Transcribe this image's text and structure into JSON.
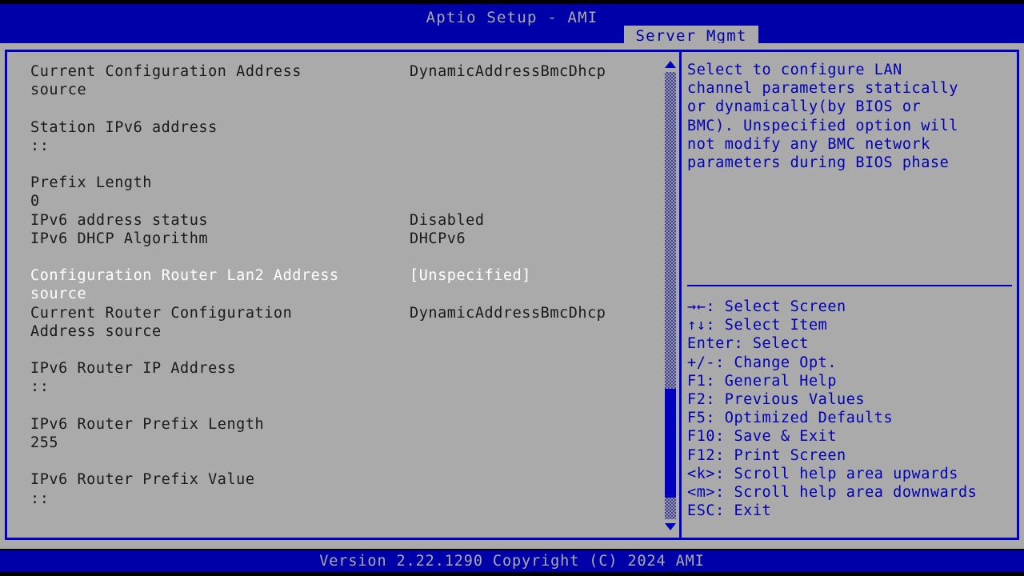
{
  "header": {
    "title": "Aptio Setup - AMI",
    "active_tab": "Server Mgmt",
    "colors": {
      "title_bar": "#0000a8",
      "tab_bg": "#aaaaaa",
      "tab_fg": "#0000a8"
    }
  },
  "settings_list": {
    "selected_index": 7,
    "rows": [
      {
        "label": "Current Configuration Address",
        "value": "DynamicAddressBmcDhcp",
        "selected": false
      },
      {
        "label": "source",
        "value": "",
        "selected": false
      },
      {
        "label": "",
        "value": "",
        "selected": false
      },
      {
        "label": "Station IPv6 address",
        "value": "",
        "selected": false
      },
      {
        "label": "::",
        "value": "",
        "selected": false
      },
      {
        "label": "",
        "value": "",
        "selected": false
      },
      {
        "label": "Prefix Length",
        "value": "",
        "selected": false
      },
      {
        "label": "0",
        "value": "",
        "selected": false
      },
      {
        "label": "IPv6 address status",
        "value": "Disabled",
        "selected": false
      },
      {
        "label": "IPv6 DHCP Algorithm",
        "value": "DHCPv6",
        "selected": false
      },
      {
        "label": "",
        "value": "",
        "selected": false
      },
      {
        "label": "Configuration Router Lan2 Address",
        "value": "[Unspecified]",
        "selected": true
      },
      {
        "label": "source",
        "value": "",
        "selected": true
      },
      {
        "label": "Current Router Configuration",
        "value": "DynamicAddressBmcDhcp",
        "selected": false
      },
      {
        "label": "Address source",
        "value": "",
        "selected": false
      },
      {
        "label": "",
        "value": "",
        "selected": false
      },
      {
        "label": "IPv6 Router IP Address",
        "value": "",
        "selected": false
      },
      {
        "label": "::",
        "value": "",
        "selected": false
      },
      {
        "label": "",
        "value": "",
        "selected": false
      },
      {
        "label": "IPv6 Router Prefix Length",
        "value": "",
        "selected": false
      },
      {
        "label": "255",
        "value": "",
        "selected": false
      },
      {
        "label": "",
        "value": "",
        "selected": false
      },
      {
        "label": "IPv6 Router Prefix Value",
        "value": "",
        "selected": false
      },
      {
        "label": "::",
        "value": "",
        "selected": false
      }
    ]
  },
  "scrollbar": {
    "up_arrow": "scroll-up-arrow",
    "down_arrow": "scroll-down-arrow",
    "thumb_top_pct": 70,
    "thumb_height_pct": 24
  },
  "help": {
    "description_lines": [
      "Select to configure LAN",
      "channel parameters statically",
      "or dynamically(by BIOS or",
      "BMC). Unspecified option will",
      "not modify any BMC network",
      "parameters during BIOS phase"
    ],
    "keys": [
      {
        "key": "→←",
        "text": ": Select Screen"
      },
      {
        "key": "↑↓",
        "text": ": Select Item"
      },
      {
        "key": "Enter",
        "text": ": Select"
      },
      {
        "key": "+/-",
        "text": ": Change Opt."
      },
      {
        "key": "F1",
        "text": ": General Help"
      },
      {
        "key": "F2",
        "text": ": Previous Values"
      },
      {
        "key": "F5",
        "text": ": Optimized Defaults"
      },
      {
        "key": "F10",
        "text": ": Save & Exit"
      },
      {
        "key": "F12",
        "text": ": Print Screen"
      },
      {
        "key": "<k>",
        "text": ": Scroll help area upwards"
      },
      {
        "key": "<m>",
        "text": ": Scroll help area downwards"
      },
      {
        "key": "ESC",
        "text": ": Exit"
      }
    ]
  },
  "footer": {
    "version_text": "Version 2.22.1290 Copyright (C) 2024 AMI"
  }
}
